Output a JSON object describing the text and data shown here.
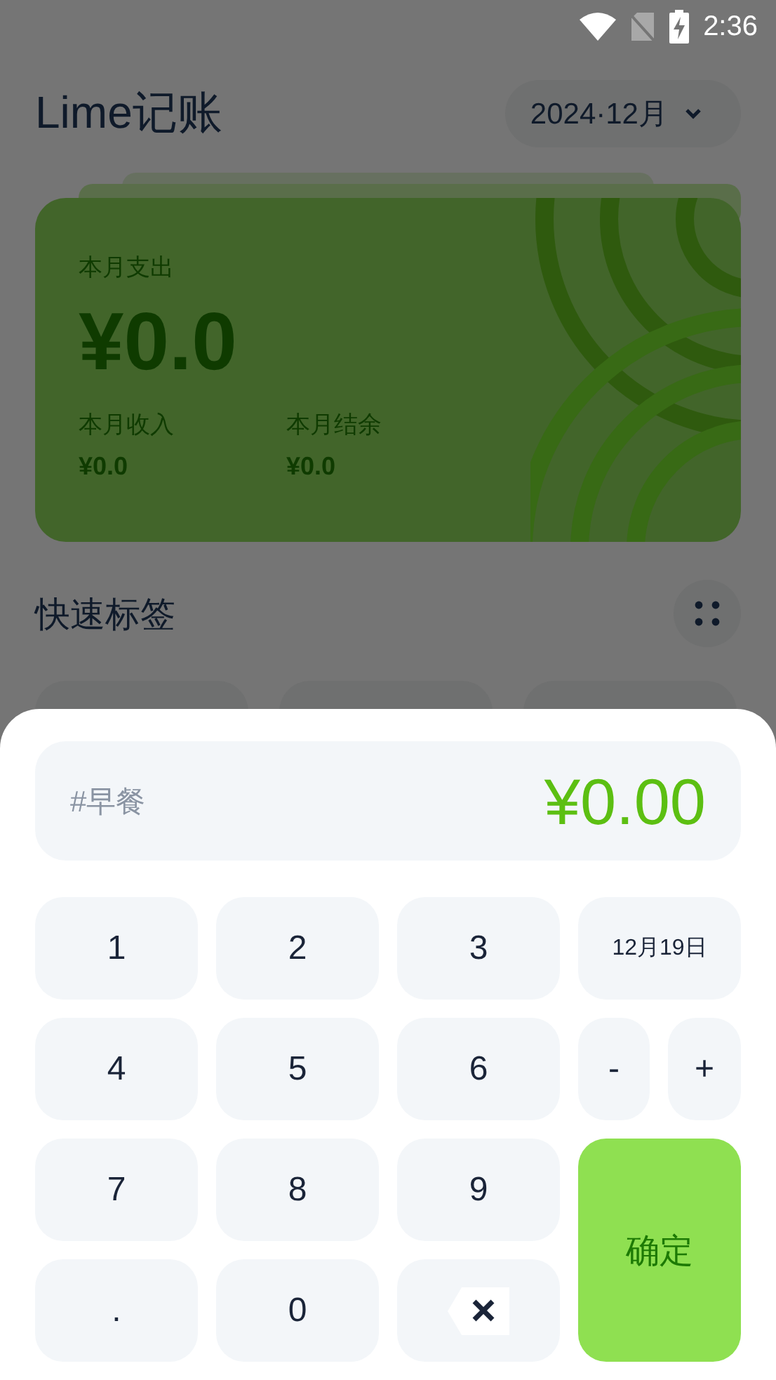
{
  "status_bar": {
    "time": "2:36"
  },
  "header": {
    "title": "Lime记账",
    "month_picker": "2024·12月"
  },
  "summary_card": {
    "expense_label": "本月支出",
    "expense": "¥0.0",
    "stats": [
      {
        "label": "本月收入",
        "value": "¥0.0"
      },
      {
        "label": "本月结余",
        "value": "¥0.0"
      }
    ]
  },
  "quick_tags": {
    "title": "快速标签"
  },
  "entry_sheet": {
    "tag": "#早餐",
    "amount": "¥0.00",
    "keys": [
      {
        "kind": "digit",
        "label": "1"
      },
      {
        "kind": "digit",
        "label": "2"
      },
      {
        "kind": "digit",
        "label": "3"
      },
      {
        "kind": "date",
        "label": "12月19日"
      },
      {
        "kind": "digit",
        "label": "4"
      },
      {
        "kind": "digit",
        "label": "5"
      },
      {
        "kind": "digit",
        "label": "6"
      },
      {
        "kind": "op",
        "label": "-"
      },
      {
        "kind": "op",
        "label": "+"
      },
      {
        "kind": "digit",
        "label": "7"
      },
      {
        "kind": "digit",
        "label": "8"
      },
      {
        "kind": "digit",
        "label": "9"
      },
      {
        "kind": "confirm",
        "label": "确定"
      },
      {
        "kind": "digit",
        "label": "."
      },
      {
        "kind": "digit",
        "label": "0"
      },
      {
        "kind": "backspace"
      }
    ]
  }
}
